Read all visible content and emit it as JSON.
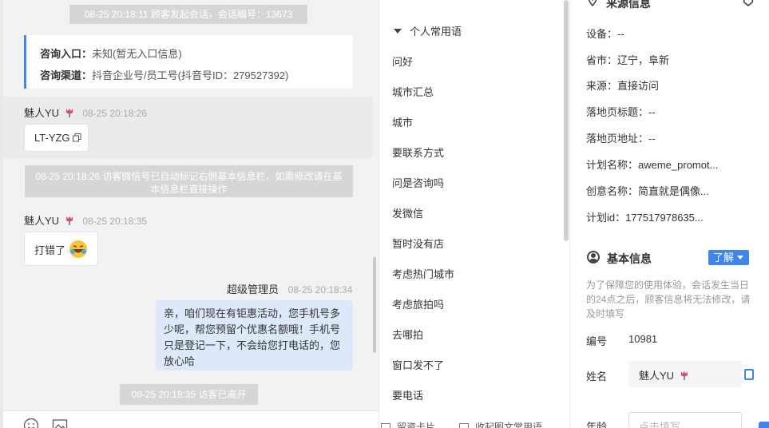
{
  "chat": {
    "session_notice": "08-25 20:18:11 顾客发起会话，会话编号：13673",
    "entry": {
      "label": "咨询入口：",
      "value": "未知(暂无入口信息)"
    },
    "channel": {
      "label": "咨询渠道：",
      "value": "抖音企业号/员工号(抖音号ID：279527392)"
    },
    "msg1": {
      "sender": "魅人YU",
      "time": "08-25 20:18:26",
      "text": "LT-YZG"
    },
    "wechat_notice": "08-25 20:18:26 访客微信号已自动标记右侧基本信息栏，如需修改请在基本信息栏直接操作",
    "msg2": {
      "sender": "魅人YU",
      "time": "08-25 20:18:35",
      "text": "打错了"
    },
    "msg3": {
      "sender": "超级管理员",
      "time": "08-25 20:18:34",
      "text": "亲，咱们现在有钜惠活动，您手机号多少呢，帮您预留个优惠名额哦！手机号只是登记一下，不会给您打电话的，您放心哈"
    },
    "left_notice": "08-25 20:18:35 访客已离开",
    "toolbar": {
      "icons": [
        "emoji-icon",
        "image-icon"
      ]
    }
  },
  "phrases": {
    "group": "个人常用语",
    "items": [
      "问好",
      "城市汇总",
      "城市",
      "要联系方式",
      "问是咨询吗",
      "发微信",
      "暂时没有店",
      "考虑热门城市",
      "考虑旅拍吗",
      "去哪拍",
      "窗口发不了",
      "要电话"
    ],
    "footer_left": "留资卡片",
    "footer_right": "收起图文常用语"
  },
  "info": {
    "source_title": "来源信息",
    "device": "设备：--",
    "province": "省市：辽宁，阜新",
    "source": "来源：直接访问",
    "landing_title": "落地页标题：--",
    "landing_url": "落地页地址：--",
    "plan_name": "计划名称：aweme_promot...",
    "creative_name": "创意名称：简直就是偶像...",
    "plan_id": "计划id：177517978635...",
    "basic_title": "基本信息",
    "know_btn": "了解",
    "note": "为了保障您的使用体验，会话发生当日的24点之后，顾客信息将无法修改，请及时填写",
    "number_label": "编号",
    "number_value": "10981",
    "name_label": "姓名",
    "name_value": "魅人YU",
    "age_label": "年龄",
    "age_placeholder": "点击填写"
  },
  "colors": {
    "accent": "#3d86f0",
    "my_bubble": "#dde8fa",
    "system_pill": "#d6d6d6"
  }
}
